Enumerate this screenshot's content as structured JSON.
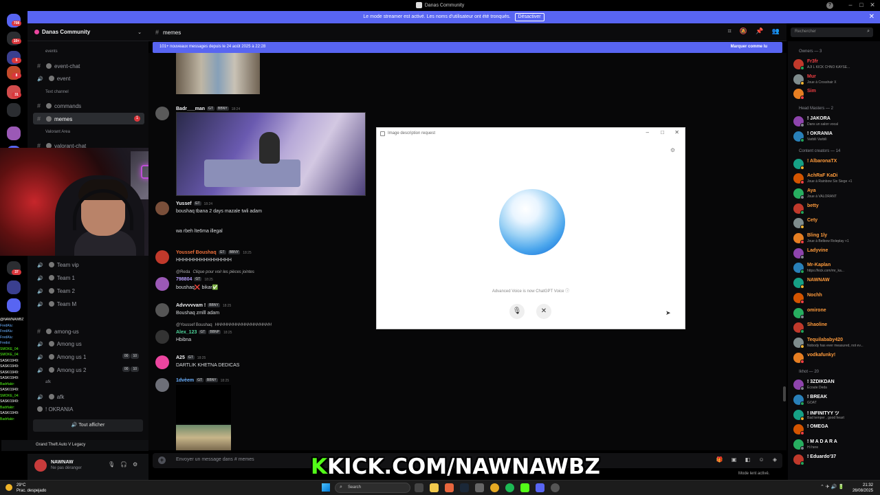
{
  "window": {
    "title": "Danas Community"
  },
  "banner": {
    "text": "Le mode streamer est activé. Les noms d'utilisateur ont été tronqués.",
    "button": "Désactiver"
  },
  "server": {
    "name": "Danas Community",
    "channels": [
      {
        "kind": "category",
        "label": "events"
      },
      {
        "kind": "text",
        "label": "event-chat"
      },
      {
        "kind": "voice",
        "label": "event"
      },
      {
        "kind": "category",
        "label": "Text channel"
      },
      {
        "kind": "text",
        "label": "commands"
      },
      {
        "kind": "text",
        "label": "memes",
        "active": true,
        "unread": "1"
      },
      {
        "kind": "category",
        "label": "Valorant Area"
      },
      {
        "kind": "text",
        "label": "valorant-chat"
      },
      {
        "kind": "voice",
        "label": "Team vip"
      },
      {
        "kind": "voice",
        "label": "Team 1"
      },
      {
        "kind": "voice",
        "label": "Team 2"
      },
      {
        "kind": "voice",
        "label": "Team M"
      },
      {
        "kind": "text",
        "label": "among-us"
      },
      {
        "kind": "voice",
        "label": "Among us"
      },
      {
        "kind": "voice",
        "label": "Among us 1",
        "counts": [
          "00",
          "10"
        ]
      },
      {
        "kind": "voice",
        "label": "Among us 2",
        "counts": [
          "00",
          "10"
        ]
      },
      {
        "kind": "category",
        "label": "afk"
      },
      {
        "kind": "voice",
        "label": "afk"
      },
      {
        "kind": "user",
        "label": "! OKRANIA"
      }
    ],
    "show_all": "Tout afficher"
  },
  "rail_badges": [
    "708",
    "10+",
    "5",
    "8",
    "31",
    "37"
  ],
  "kick_chat": [
    {
      "name": "@NAWNAWBZ",
      "color": "#ffffff"
    },
    {
      "name": "FredAlu:",
      "color": "#6ab0ff"
    },
    {
      "name": "FredAlu:",
      "color": "#6ab0ff"
    },
    {
      "name": "FredAlu:",
      "color": "#6ab0ff"
    },
    {
      "name": "Fredoi:",
      "color": "#6ab0ff"
    },
    {
      "name": "SMOKE_04:",
      "color": "#53fc18"
    },
    {
      "name": "SMOKE_04:",
      "color": "#53fc18"
    },
    {
      "name": "SASKI1949:",
      "color": "#ffffff"
    },
    {
      "name": "SASKI1949:",
      "color": "#ffffff"
    },
    {
      "name": "SASKI1949:",
      "color": "#ffffff"
    },
    {
      "name": "SASKI1949:",
      "color": "#ffffff"
    },
    {
      "name": "Badrfakir:",
      "color": "#53fc18"
    },
    {
      "name": "SASKI1949:",
      "color": "#ffffff"
    },
    {
      "name": "SMOKE_04:",
      "color": "#53fc18"
    },
    {
      "name": "SASKI1949:",
      "color": "#ffffff"
    },
    {
      "name": "Badrfakir:",
      "color": "#53fc18"
    },
    {
      "name": "SASKI1949:",
      "color": "#ffffff"
    },
    {
      "name": "Badrfakir:",
      "color": "#53fc18"
    }
  ],
  "now_playing": "Grand Theft Auto V Legacy",
  "user": {
    "name": "NAWNAW",
    "status": "Ne pas déranger"
  },
  "channel": {
    "name": "memes",
    "search_placeholder": "Rechercher"
  },
  "new_messages": {
    "text": "101+ nouveaux messages depuis le 24 août 2025 à 22:28",
    "action": "Marquer comme lu"
  },
  "messages": [
    {
      "user": "Badr___man",
      "tags": [
        "GT",
        "BBNY"
      ],
      "time": "18:24",
      "color": "#f2f3f5",
      "body": ""
    },
    {
      "user": "Yussef",
      "tags": [
        "GT"
      ],
      "time": "18:24",
      "color": "#f2f3f5",
      "body": "boushaq tbana 2 days mazale twli adam"
    },
    {
      "user": "",
      "tags": [],
      "time": "18:24",
      "color": "#f2f3f5",
      "body": "wa rbeh lte6ma illegal"
    },
    {
      "user": "Youssef Boushaq",
      "tags": [
        "GT",
        "BBNY"
      ],
      "time": "18:25",
      "color": "#f0703b",
      "body": "HHHHHHHHHHHHHHHH"
    },
    {
      "user": "798804",
      "tags": [
        "GT"
      ],
      "time": "18:25",
      "color": "#b9a0ff",
      "body": "boushaq❌ bikar✅",
      "reply_user": "@Reda",
      "reply_text": "Clique pour voir les pièces jointes"
    },
    {
      "user": "Advvvvvam !",
      "tags": [
        "BBNY"
      ],
      "time": "18:25",
      "color": "#f2f3f5",
      "body": "Boushaq zmlll adam"
    },
    {
      "user": "Alex_123",
      "tags": [
        "GT",
        "BBNP"
      ],
      "time": "18:25",
      "color": "#4fd69c",
      "body": "Hbibna",
      "reply_user": "@Youssef Boushaq",
      "reply_text": "HHHHHHHHHHHHHHHHHHH"
    },
    {
      "user": "A25",
      "tags": [
        "GT"
      ],
      "time": "18:25",
      "color": "#f2f3f5",
      "body": "DARTLIK KHETNA DEDICAS"
    },
    {
      "user": "1dvèem",
      "tags": [
        "GT",
        "BBNY"
      ],
      "time": "18:25",
      "color": "#6ab0ff",
      "body": ""
    }
  ],
  "composer": {
    "placeholder": "Envoyer un message dans #",
    "channel": "memes",
    "slowmode": "Mode lent activé."
  },
  "overlay_brand": {
    "k": "K",
    "rest": "KICK.COM/NAWNAWBZ"
  },
  "members": {
    "categories": [
      {
        "label": "Owners — 3",
        "members": [
          {
            "name": "Fr3fr",
            "activity": "AJI L KICK CHNO KAYSE...",
            "color": "#f23f43"
          },
          {
            "name": "Mur",
            "activity": "Joue à Crosshair X",
            "color": "#f23f43"
          },
          {
            "name": "Sim",
            "activity": "",
            "color": "#f23f43"
          }
        ]
      },
      {
        "label": "Head Masters — 2",
        "members": [
          {
            "name": "! JAKORA",
            "activity": "Dans un salon vocal",
            "color": "#ffffff"
          },
          {
            "name": "! OKRANIA",
            "activity": "Varbili Varbili",
            "color": "#ffffff"
          }
        ]
      },
      {
        "label": "Content creators — 14",
        "members": [
          {
            "name": "! AlbaronaTX",
            "activity": "",
            "color": "#ff9b3c"
          },
          {
            "name": "AchRaF KaDi",
            "activity": "Joue à Rainbow Six Siege +1",
            "color": "#ff9b3c"
          },
          {
            "name": "Aya",
            "activity": "Joue à VALORANT",
            "color": "#ff9b3c"
          },
          {
            "name": "betty",
            "activity": "",
            "color": "#ff9b3c"
          },
          {
            "name": "Cety",
            "activity": "",
            "color": "#ff9b3c"
          },
          {
            "name": "Bling 1ly",
            "activity": "Joue à Belbow Roleplay +1",
            "color": "#ff9b3c"
          },
          {
            "name": "Ladyvine",
            "activity": "",
            "color": "#ff9b3c"
          },
          {
            "name": "Mr-Kaplan",
            "activity": "https://kick.com/mr_ka...",
            "color": "#ff9b3c"
          },
          {
            "name": "NAWNAW",
            "activity": "",
            "color": "#ff9b3c"
          },
          {
            "name": "Nochh",
            "activity": "",
            "color": "#ff9b3c"
          },
          {
            "name": "omirone",
            "activity": "",
            "color": "#ff9b3c"
          },
          {
            "name": "Shaoline",
            "activity": "",
            "color": "#ff9b3c"
          },
          {
            "name": "Tequilababy420",
            "activity": "Nobody has ever measured, not ev...",
            "color": "#ff9b3c"
          },
          {
            "name": "vodkafunky!",
            "activity": "",
            "color": "#ff9b3c"
          }
        ]
      },
      {
        "label": "Ikhot — 20",
        "members": [
          {
            "name": "! 3ZDIKDAN",
            "activity": "Écoute Deda",
            "color": "#ffffff"
          },
          {
            "name": "! BREAK",
            "activity": "GOAT",
            "color": "#ffffff"
          },
          {
            "name": "! INFINITYY ツ",
            "activity": "Bad temper , good heart",
            "color": "#ffffff"
          },
          {
            "name": "! OMEGA",
            "activity": "",
            "color": "#ffffff"
          },
          {
            "name": "! M A D A R A",
            "activity": "Hi here",
            "color": "#ffffff"
          },
          {
            "name": "! Eduardo'37",
            "activity": "",
            "color": "#ffffff"
          }
        ]
      }
    ]
  },
  "modal": {
    "title": "Image description request",
    "note": "Advanced Voice is now ChatGPT Voice"
  },
  "taskbar": {
    "weather_temp": "29°C",
    "weather_desc": "Prac. despejado",
    "search": "Search",
    "time": "21:32",
    "date": "26/08/2025"
  }
}
